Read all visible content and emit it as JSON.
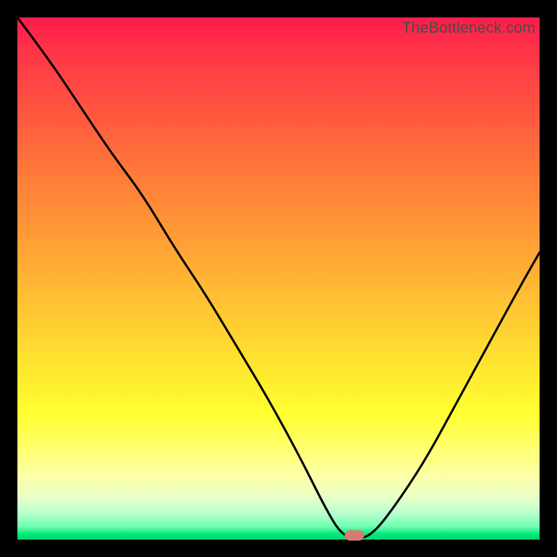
{
  "watermark": "TheBottleneck.com",
  "marker": {
    "x_pct": 64.5,
    "y_pct": 99.2
  },
  "chart_data": {
    "type": "line",
    "title": "",
    "xlabel": "",
    "ylabel": "",
    "xlim": [
      0,
      100
    ],
    "ylim": [
      0,
      100
    ],
    "grid": false,
    "legend": false,
    "series": [
      {
        "name": "bottleneck-curve",
        "x": [
          0,
          6,
          12,
          18,
          24,
          30,
          36,
          42,
          48,
          54,
          59,
          62,
          65,
          68,
          72,
          78,
          84,
          90,
          96,
          100
        ],
        "y": [
          100,
          92,
          83,
          74,
          66,
          56,
          47,
          37,
          27,
          16,
          6,
          1,
          0,
          1,
          6,
          15,
          26,
          37,
          48,
          55
        ]
      }
    ],
    "background_gradient_stops": [
      {
        "pos": 0,
        "color": "#ff1a4b"
      },
      {
        "pos": 18,
        "color": "#ff5640"
      },
      {
        "pos": 42,
        "color": "#ff9c36"
      },
      {
        "pos": 66,
        "color": "#ffe330"
      },
      {
        "pos": 82,
        "color": "#ffff6a"
      },
      {
        "pos": 95,
        "color": "#b6ffcf"
      },
      {
        "pos": 100,
        "color": "#00d86a"
      }
    ],
    "annotations": [
      {
        "type": "marker",
        "shape": "pill",
        "color": "#d87a74",
        "x": 64.5,
        "y": 0.8
      }
    ]
  }
}
